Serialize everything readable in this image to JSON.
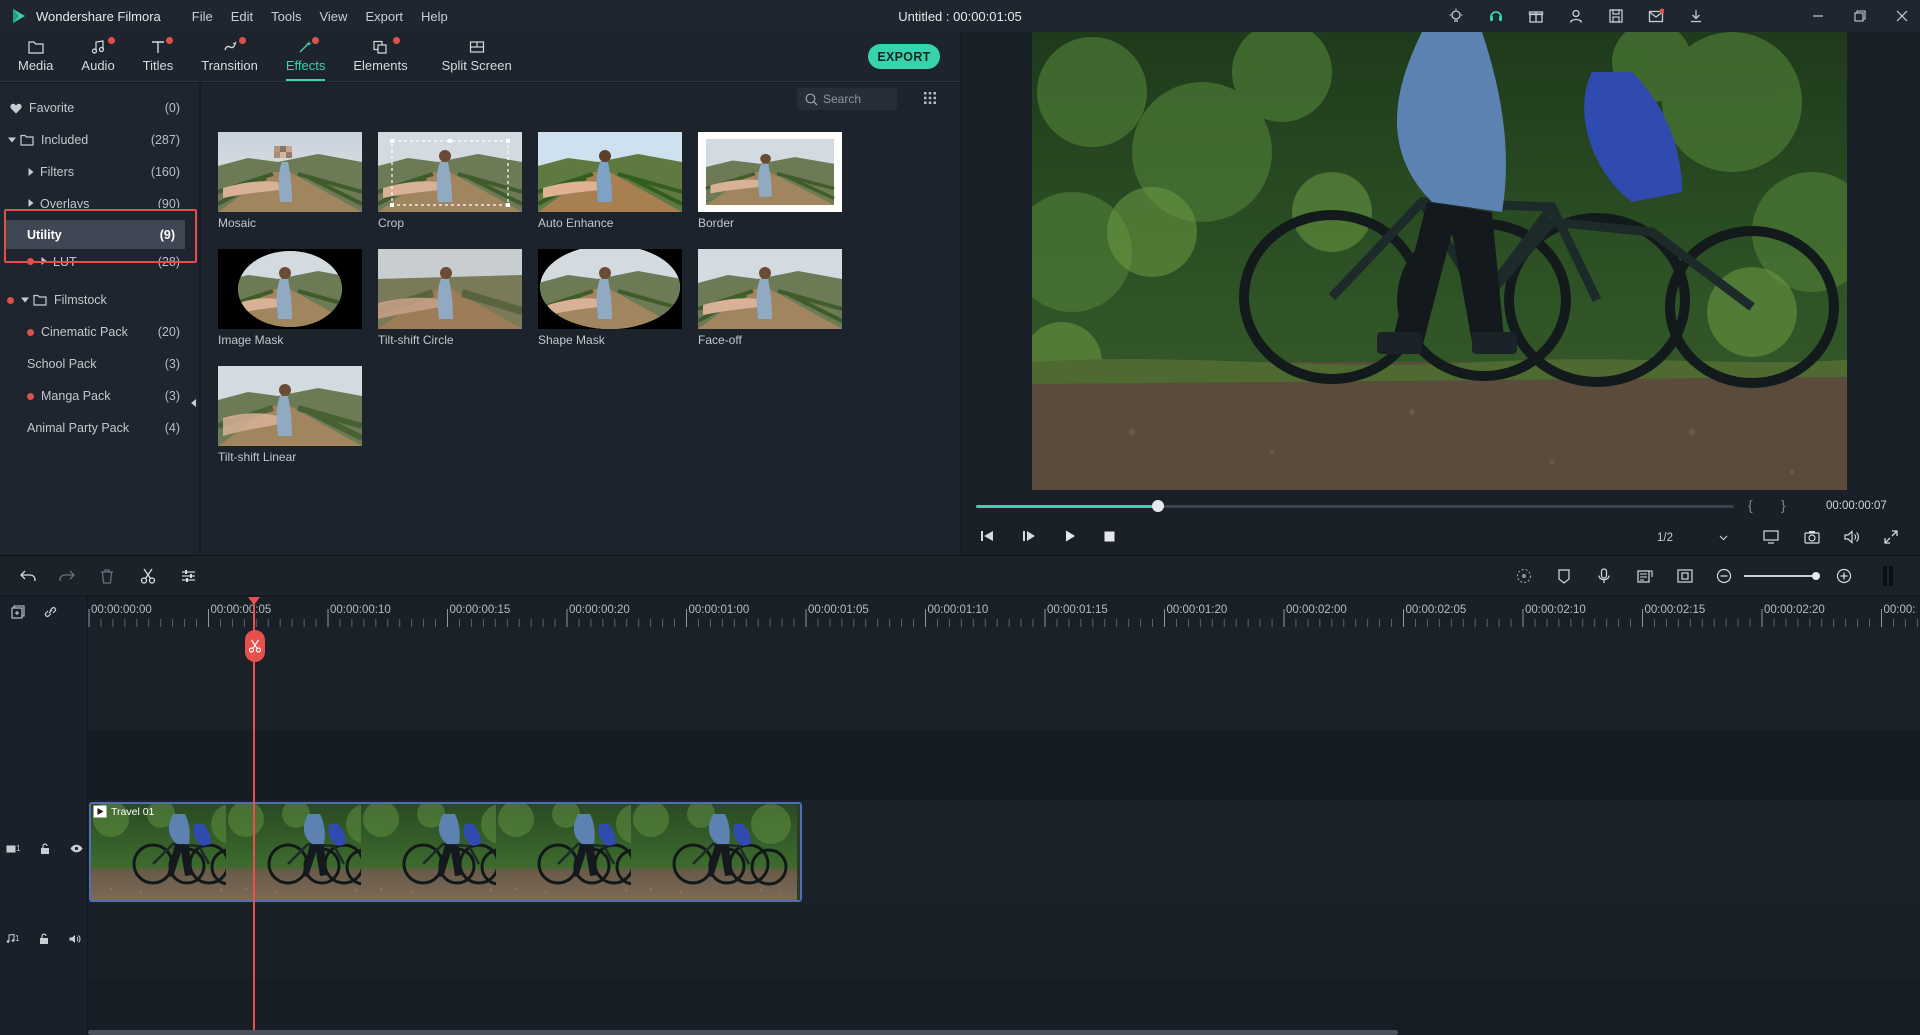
{
  "app": {
    "name": "Wondershare Filmora",
    "window_title": "Untitled : 00:00:01:05"
  },
  "menu": [
    "File",
    "Edit",
    "Tools",
    "View",
    "Export",
    "Help"
  ],
  "toolbar": {
    "tabs": [
      {
        "label": "Media",
        "icon": "folder-icon",
        "dot": false
      },
      {
        "label": "Audio",
        "icon": "music-note-icon",
        "dot": true
      },
      {
        "label": "Titles",
        "icon": "text-icon",
        "dot": true
      },
      {
        "label": "Transition",
        "icon": "transition-icon",
        "dot": true
      },
      {
        "label": "Effects",
        "icon": "effects-icon",
        "dot": true,
        "active": true
      },
      {
        "label": "Elements",
        "icon": "elements-icon",
        "dot": true
      },
      {
        "label": "Split Screen",
        "icon": "split-screen-icon",
        "dot": false
      }
    ],
    "export_label": "EXPORT"
  },
  "sidebar": {
    "items": [
      {
        "label": "Favorite",
        "count": "(0)"
      },
      {
        "label": "Included",
        "count": "(287)"
      },
      {
        "label": "Filters",
        "count": "(160)"
      },
      {
        "label": "Overlays",
        "count": "(90)"
      },
      {
        "label": "Utility",
        "count": "(9)"
      },
      {
        "label": "LUT",
        "count": "(28)"
      },
      {
        "label": "Filmstock",
        "count": ""
      },
      {
        "label": "Cinematic Pack",
        "count": "(20)"
      },
      {
        "label": "School Pack",
        "count": "(3)"
      },
      {
        "label": "Manga Pack",
        "count": "(3)"
      },
      {
        "label": "Animal Party Pack",
        "count": "(4)"
      }
    ]
  },
  "library": {
    "search_placeholder": "Search",
    "effects": [
      "Mosaic",
      "Crop",
      "Auto Enhance",
      "Border",
      "Image Mask",
      "Tilt-shift Circle",
      "Shape Mask",
      "Face-off",
      "Tilt-shift Linear"
    ]
  },
  "player": {
    "timecode": "00:00:00:07",
    "quality": "1/2",
    "progress": 0.24,
    "bracket_in": "{",
    "bracket_out": "}"
  },
  "timeline": {
    "ticks": [
      "00:00:00:00",
      "00:00:00:05",
      "00:00:00:10",
      "00:00:00:15",
      "00:00:00:20",
      "00:00:01:00",
      "00:00:01:05",
      "00:00:01:10",
      "00:00:01:15",
      "00:00:01:20",
      "00:00:02:00",
      "00:00:02:05",
      "00:00:02:10",
      "00:00:02:15",
      "00:00:02:20",
      "00:00:"
    ],
    "clip_name": "Travel 01",
    "video_track": "1",
    "audio_track": "1"
  },
  "colors": {
    "accent": "#3fd0b1",
    "playhead": "#e8504c",
    "highlight_box": "#e0504b",
    "clip_border": "#4f6fb2"
  }
}
